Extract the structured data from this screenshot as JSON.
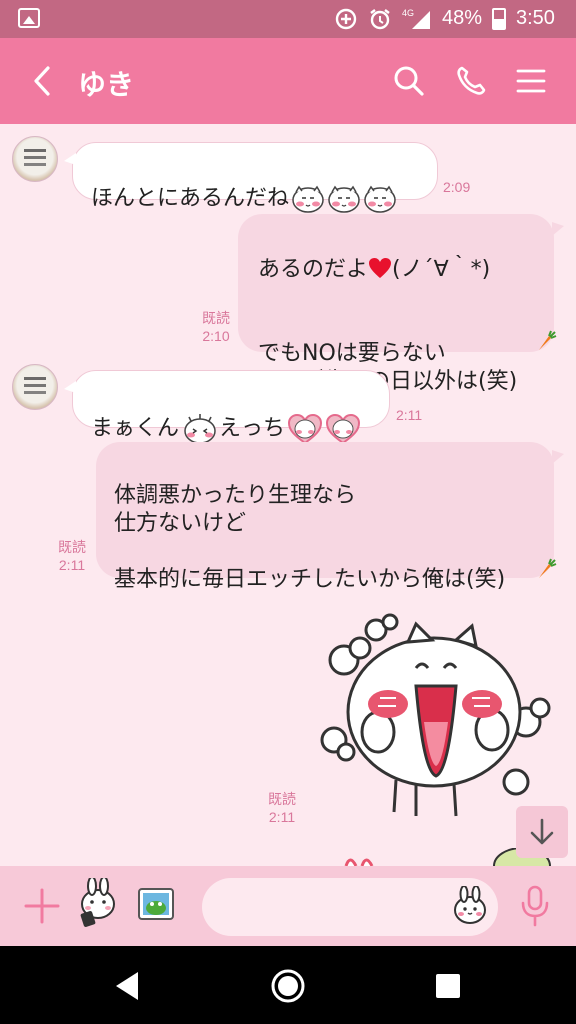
{
  "status_bar": {
    "network": "4G",
    "battery_percent": "48%",
    "battery_level": 0.48,
    "time": "3:50"
  },
  "header": {
    "title": "ゆき",
    "icons": [
      "back-arrow-icon",
      "search-icon",
      "phone-icon",
      "menu-icon"
    ]
  },
  "messages": [
    {
      "id": "m1",
      "side": "in",
      "text": "ほんとにあるんだね",
      "emoji": [
        "blush-cat-emoji",
        "blush-cat-emoji",
        "blush-cat-emoji"
      ],
      "time": "2:09"
    },
    {
      "id": "m2",
      "side": "out",
      "text_top": "あるのだよ",
      "text_heart_after": "(ノ´∀｀*)",
      "text_bottom": "でもNOは要らない\nゆきが生理の日以外は(笑)",
      "read": "既読",
      "time": "2:10"
    },
    {
      "id": "m3",
      "side": "in",
      "text_a": "まぁくん",
      "text_b": "えっち",
      "time": "2:11"
    },
    {
      "id": "m4",
      "side": "out",
      "text": "体調悪かったり生理なら\n仕方ないけど\n\n基本的に毎日エッチしたいから俺は(笑)",
      "read": "既読",
      "time": "2:11"
    },
    {
      "id": "m5",
      "side": "out",
      "type": "sticker",
      "sticker": "excited-white-cat-sticker",
      "read": "既読",
      "time": "2:11"
    }
  ],
  "input": {
    "placeholder": "",
    "value": ""
  },
  "colors": {
    "header_bg": "#f17aa0",
    "status_bg": "#c26883",
    "chat_bg": "#fde9ef",
    "out_bubble": "#f7d7e2",
    "in_bubble": "#ffffff",
    "meta_text": "#d9779b",
    "input_bar_bg": "#f7c9d8"
  }
}
